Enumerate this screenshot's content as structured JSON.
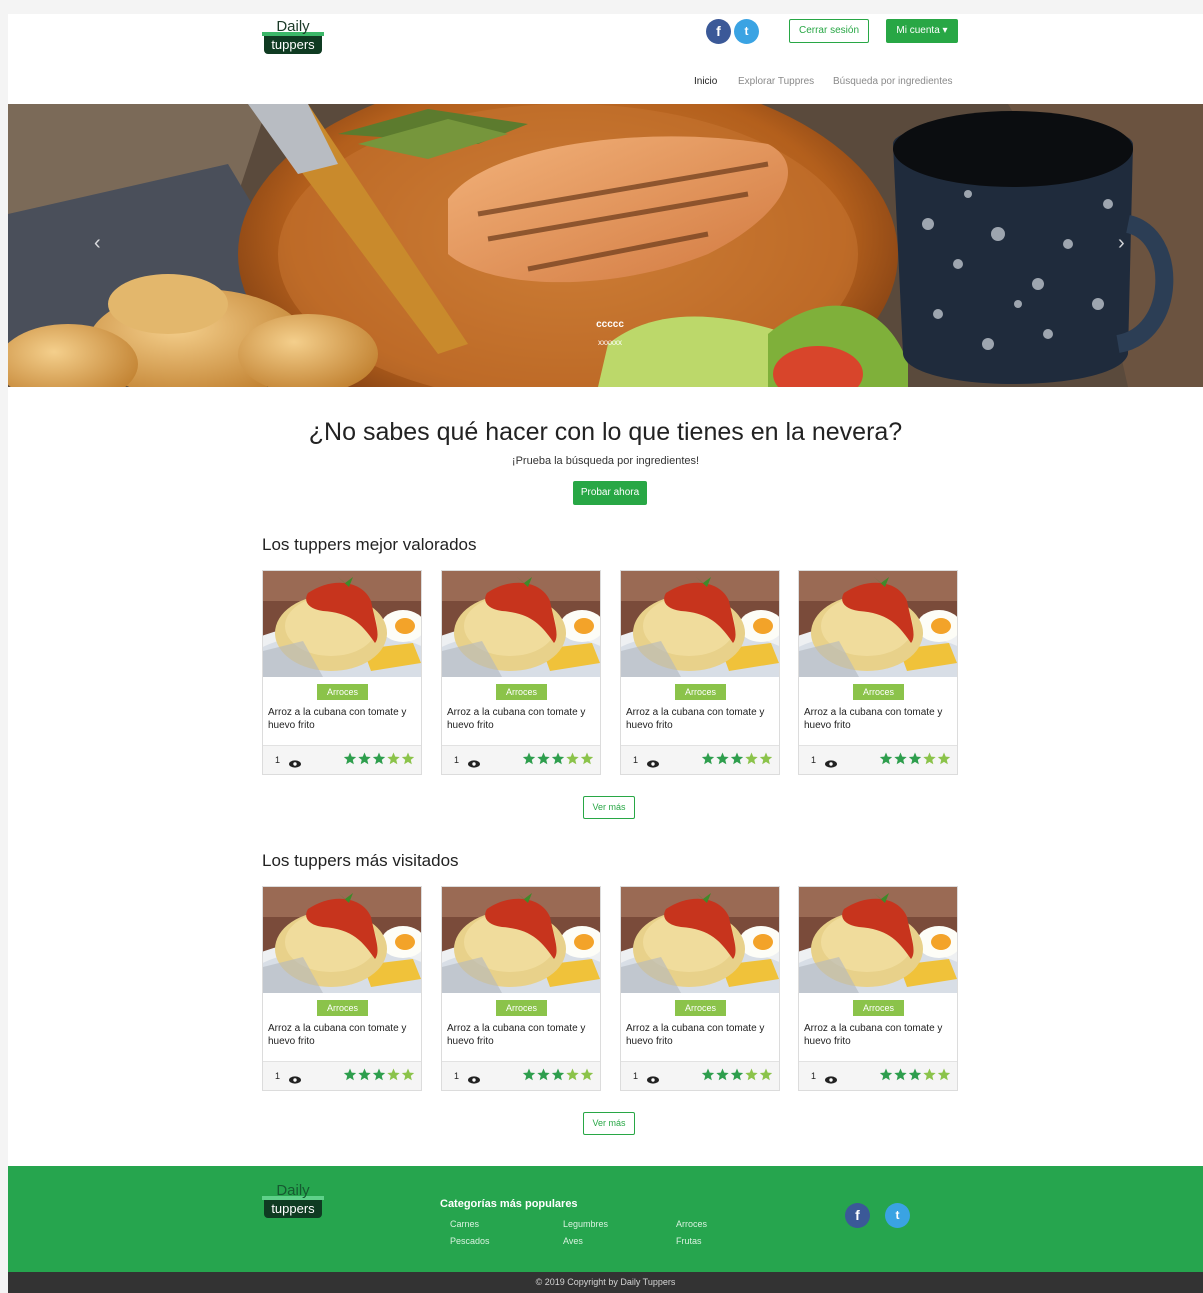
{
  "header": {
    "logo": {
      "line1": "Daily",
      "line2": "tuppers"
    },
    "social": {
      "facebook": "f",
      "twitter": "t"
    },
    "logout_label": "Cerrar sesión",
    "account_label": "Mi cuenta",
    "account_caret": "▾",
    "nav": [
      "Inicio",
      "Explorar Tuppres",
      "Búsqueda por ingredientes"
    ]
  },
  "hero": {
    "caption_title": "ccccc",
    "caption_text": "xxxxxx",
    "prev": "‹",
    "next": "›"
  },
  "promo": {
    "headline": "¿No sabes qué hacer con lo que tienes en la nevera?",
    "subline": "¡Prueba la búsqueda por ingredientes!",
    "button": "Probar ahora"
  },
  "sections": [
    {
      "title": "Los tuppers mejor valorados",
      "more": "Ver más",
      "cards": [
        {
          "category": "Arroces",
          "title": "Arroz a la cubana con tomate y huevo frito",
          "views": "1",
          "rating": 3
        },
        {
          "category": "Arroces",
          "title": "Arroz a la cubana con tomate y huevo frito",
          "views": "1",
          "rating": 3
        },
        {
          "category": "Arroces",
          "title": "Arroz a la cubana con tomate y huevo frito",
          "views": "1",
          "rating": 3
        },
        {
          "category": "Arroces",
          "title": "Arroz a la cubana con tomate y huevo frito",
          "views": "1",
          "rating": 3
        }
      ]
    },
    {
      "title": "Los tuppers más visitados",
      "more": "Ver más",
      "cards": [
        {
          "category": "Arroces",
          "title": "Arroz a la cubana con tomate y huevo frito",
          "views": "1",
          "rating": 3
        },
        {
          "category": "Arroces",
          "title": "Arroz a la cubana con tomate y huevo frito",
          "views": "1",
          "rating": 3
        },
        {
          "category": "Arroces",
          "title": "Arroz a la cubana con tomate y huevo frito",
          "views": "1",
          "rating": 3
        },
        {
          "category": "Arroces",
          "title": "Arroz a la cubana con tomate y huevo frito",
          "views": "1",
          "rating": 3
        }
      ]
    }
  ],
  "footer": {
    "logo": {
      "line1": "Daily",
      "line2": "tuppers"
    },
    "categories_title": "Categorías más populares",
    "categories": [
      "Carnes",
      "Legumbres",
      "Arroces",
      "Pescados",
      "Aves",
      "Frutas"
    ],
    "copyright": "© 2019 Copyright by Daily Tuppers"
  },
  "colors": {
    "brand_green": "#28a745",
    "badge_green": "#8bc34a",
    "star_dark": "#2e9e4d",
    "star_light": "#8bc34a"
  }
}
